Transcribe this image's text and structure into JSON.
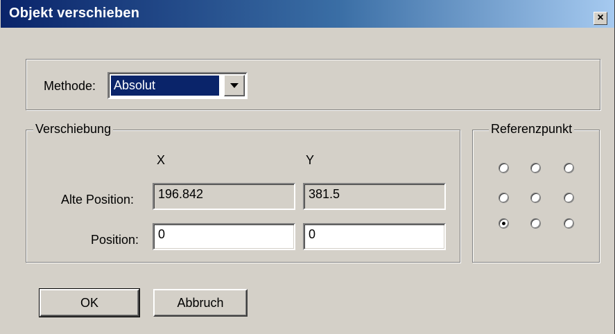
{
  "dialog": {
    "title": "Objekt verschieben",
    "close_glyph": "×"
  },
  "method": {
    "label": "Methode:",
    "selected": "Absolut"
  },
  "shift_group": {
    "legend": "Verschiebung",
    "col_x": "X",
    "col_y": "Y",
    "old_position_label": "Alte Position:",
    "old_x": "196.842",
    "old_y": "381.5",
    "position_label": "Position:",
    "new_x": "0",
    "new_y": "0"
  },
  "reference": {
    "legend": "Referenzpunkt",
    "selected_index": 6
  },
  "buttons": {
    "ok": "OK",
    "cancel": "Abbruch"
  },
  "colors": {
    "title_start": "#0a246a",
    "title_end": "#a6caf0",
    "face": "#d4d0c8",
    "selection": "#0a246a"
  }
}
